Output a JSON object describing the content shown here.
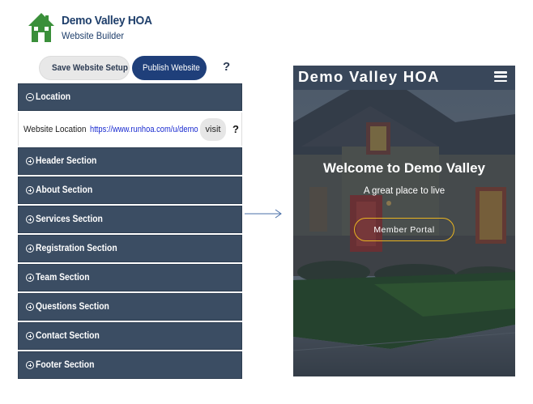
{
  "app": {
    "title": "Demo Valley HOA",
    "subtitle": "Website Builder"
  },
  "toolbar": {
    "save_label": "Save Website Setup",
    "publish_label": "Publish Website",
    "help_label": "?"
  },
  "location": {
    "header": "Location",
    "label": "Website Location",
    "url": "https://www.runhoa.com/u/demo",
    "visit_label": "visit",
    "help_label": "?"
  },
  "sections": [
    {
      "label": "Header Section"
    },
    {
      "label": "About Section"
    },
    {
      "label": "Services Section"
    },
    {
      "label": "Registration Section"
    },
    {
      "label": "Team Section"
    },
    {
      "label": "Questions Section"
    },
    {
      "label": "Contact Section"
    },
    {
      "label": "Footer Section"
    }
  ],
  "preview": {
    "brand": "Demo Valley HOA",
    "hero_title": "Welcome to Demo Valley",
    "hero_subtitle": "A great place to live",
    "cta_label": "Member Portal"
  },
  "colors": {
    "section_bg": "#3b4d63",
    "publish_bg": "#1f3f7a",
    "link": "#1a2bd0",
    "cta_border": "#e8b321",
    "logo_green": "#3a8f3a"
  },
  "icons": {
    "logo": "house-logo-icon",
    "save": "floppy-disk-icon",
    "publish": "publish-e-icon",
    "collapse": "circle-minus-icon",
    "expand": "circle-plus-icon",
    "menu": "hamburger-menu-icon",
    "arrow": "arrow-right-icon"
  }
}
